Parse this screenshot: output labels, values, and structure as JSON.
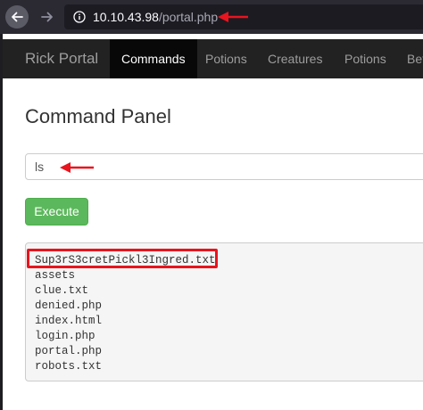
{
  "browser": {
    "url_host": "10.10.43.98",
    "url_path": "/portal.php"
  },
  "navbar": {
    "brand": "Rick Portal",
    "items": [
      {
        "label": "Commands",
        "active": true
      },
      {
        "label": "Potions",
        "active": false
      },
      {
        "label": "Creatures",
        "active": false
      },
      {
        "label": "Potions",
        "active": false
      },
      {
        "label": "Beth",
        "active": false
      }
    ]
  },
  "panel": {
    "title": "Command Panel",
    "command_value": "ls",
    "execute_label": "Execute"
  },
  "output": {
    "lines": [
      "Sup3rS3cretPickl3Ingred.txt",
      "assets",
      "clue.txt",
      "denied.php",
      "index.html",
      "login.php",
      "portal.php",
      "robots.txt"
    ]
  },
  "colors": {
    "annotation": "#e8141e",
    "execute_button": "#5cb85c",
    "navbar": "#222222"
  },
  "icons": {
    "back": "arrow-left-icon",
    "forward": "arrow-right-icon",
    "site_info": "info-circle-icon"
  }
}
